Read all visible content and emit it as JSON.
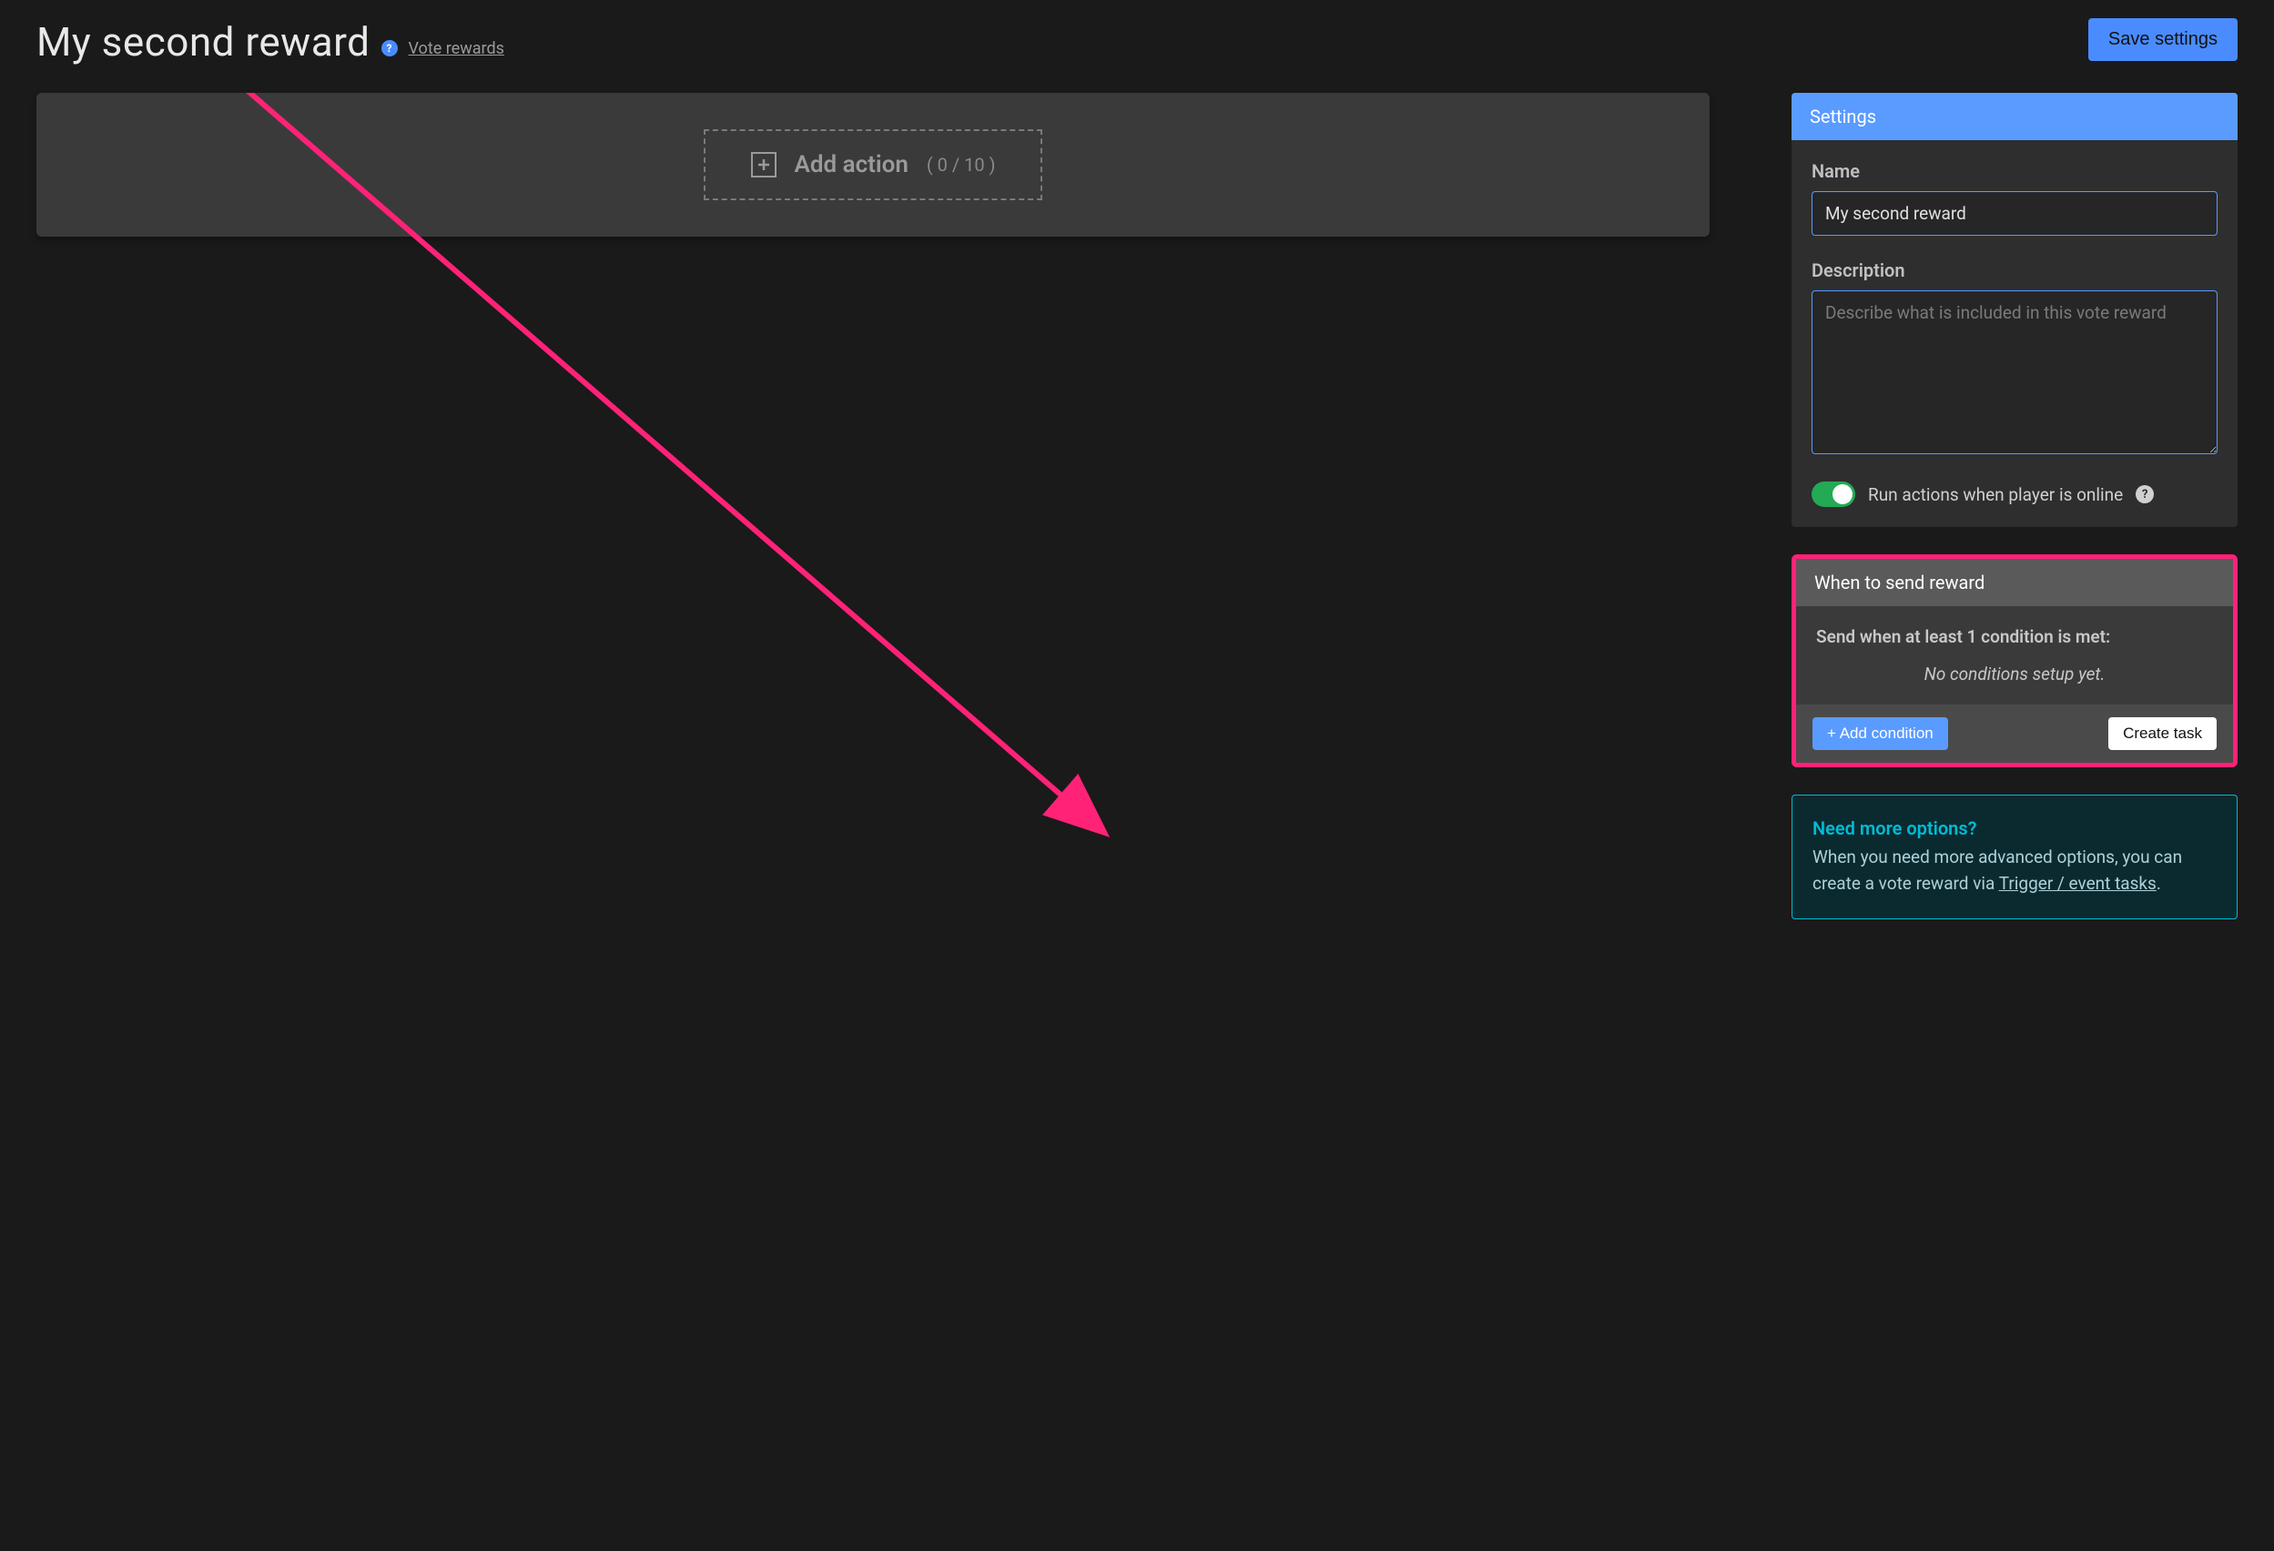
{
  "header": {
    "title": "My second reward",
    "breadcrumb_label": "Vote rewards",
    "save_label": "Save settings"
  },
  "actions": {
    "add_label": "Add action",
    "count_label": "( 0 / 10 )"
  },
  "settings": {
    "panel_title": "Settings",
    "name_label": "Name",
    "name_value": "My second reward",
    "description_label": "Description",
    "description_placeholder": "Describe what is included in this vote reward",
    "toggle_label": "Run actions when player is online"
  },
  "conditions": {
    "panel_title": "When to send reward",
    "body_heading": "Send when at least 1 condition is met:",
    "empty_text": "No conditions setup yet.",
    "add_label": "+ Add condition",
    "create_task_label": "Create task"
  },
  "info": {
    "title": "Need more options?",
    "text_before": "When you need more advanced options, you can create a vote reward via ",
    "link_label": "Trigger / event tasks",
    "text_after": "."
  }
}
